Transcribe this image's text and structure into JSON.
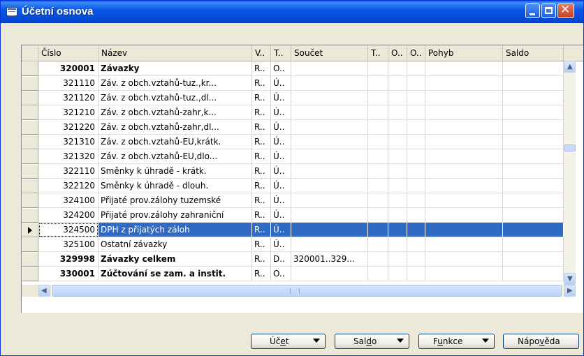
{
  "window": {
    "title": "Účetní osnova"
  },
  "columns": [
    "Číslo",
    "Název",
    "V..",
    "T..",
    "Součet",
    "T..",
    "O..",
    "O..",
    "Pohyb",
    "Saldo"
  ],
  "rows": [
    {
      "cislo": "320001",
      "nazev": "Závazky",
      "v": "R..",
      "t": "O..",
      "soucet": "",
      "bold": true
    },
    {
      "cislo": "321110",
      "nazev": "Záv. z obch.vztahů-tuz.,kr...",
      "v": "R..",
      "t": "Ú..",
      "soucet": ""
    },
    {
      "cislo": "321120",
      "nazev": "Záv. z obch.vztahů-tuz.,dl...",
      "v": "R..",
      "t": "Ú..",
      "soucet": ""
    },
    {
      "cislo": "321210",
      "nazev": "Záv. z obch.vztahů-zahr,k...",
      "v": "R..",
      "t": "Ú..",
      "soucet": ""
    },
    {
      "cislo": "321220",
      "nazev": "Záv. z obch.vztahů-zahr,dl...",
      "v": "R..",
      "t": "Ú..",
      "soucet": ""
    },
    {
      "cislo": "321310",
      "nazev": "Záv. z obch.vztahů-EU,krátk.",
      "v": "R..",
      "t": "Ú..",
      "soucet": ""
    },
    {
      "cislo": "321320",
      "nazev": "Záv. z obch.vztahů-EU,dlo...",
      "v": "R..",
      "t": "Ú..",
      "soucet": ""
    },
    {
      "cislo": "322110",
      "nazev": "Směnky k úhradě - krátk.",
      "v": "R..",
      "t": "Ú..",
      "soucet": ""
    },
    {
      "cislo": "322120",
      "nazev": "Směnky k úhradě - dlouh.",
      "v": "R..",
      "t": "Ú..",
      "soucet": ""
    },
    {
      "cislo": "324100",
      "nazev": "Přijaté prov.zálohy tuzemské",
      "v": "R..",
      "t": "Ú..",
      "soucet": ""
    },
    {
      "cislo": "324200",
      "nazev": "Přijaté prov.zálohy zahraniční",
      "v": "R..",
      "t": "Ú..",
      "soucet": ""
    },
    {
      "cislo": "324500",
      "nazev": "DPH z přijatých záloh",
      "v": "R..",
      "t": "Ú..",
      "soucet": "",
      "selected": true
    },
    {
      "cislo": "325100",
      "nazev": "Ostatní závazky",
      "v": "R..",
      "t": "Ú..",
      "soucet": ""
    },
    {
      "cislo": "329998",
      "nazev": "Závazky celkem",
      "v": "R..",
      "t": "D..",
      "soucet": "320001..329...",
      "bold": true
    },
    {
      "cislo": "330001",
      "nazev": "Zúčtování se zam. a instit.",
      "v": "R..",
      "t": "O..",
      "soucet": "",
      "bold": true
    }
  ],
  "buttons": [
    {
      "pre": "Úč",
      "ul": "e",
      "post": "t",
      "dropdown": true
    },
    {
      "pre": "Sal",
      "ul": "d",
      "post": "o",
      "dropdown": true
    },
    {
      "pre": "F",
      "ul": "u",
      "post": "nkce",
      "dropdown": true
    },
    {
      "pre": "Nápo",
      "ul": "v",
      "post": "ěda",
      "dropdown": false
    }
  ],
  "icons": {
    "window": "table-window-icon",
    "minimize": "minimize-icon",
    "maximize": "maximize-icon",
    "close": "close-icon",
    "current_row": "row-pointer-icon",
    "scroll_up": "scroll-up-icon",
    "scroll_down": "scroll-down-icon",
    "scroll_left": "scroll-left-icon",
    "scroll_right": "scroll-right-icon"
  },
  "colors": {
    "titlebar": "#0a58e6",
    "selection": "#316ac5",
    "window_bg": "#ece9d8"
  }
}
